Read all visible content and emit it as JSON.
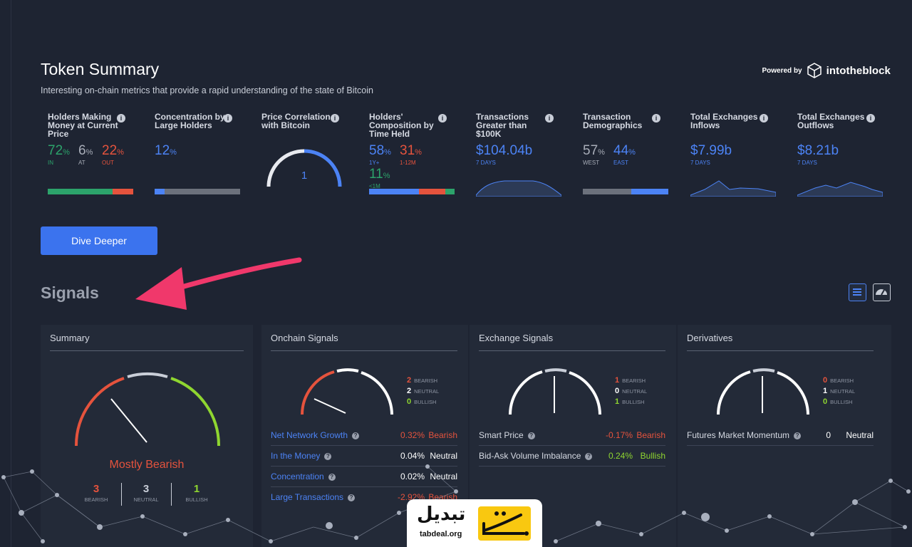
{
  "header": {
    "title": "Token Summary",
    "subtitle": "Interesting on-chain metrics that provide a rapid understanding of the state of Bitcoin",
    "powered_by": "Powered by",
    "brand": "intotheblock"
  },
  "metrics": [
    {
      "title": "Holders Making Money at Current Price",
      "values": [
        {
          "v": "72",
          "unit": "%",
          "label": "IN",
          "color": "#2ca36b"
        },
        {
          "v": "6",
          "unit": "%",
          "label": "AT",
          "color": "#a8adb8"
        },
        {
          "v": "22",
          "unit": "%",
          "label": "OUT",
          "color": "#e5533d"
        }
      ],
      "bar": [
        {
          "pct": 0.76,
          "color": "#2ca36b"
        },
        {
          "pct": 0.24,
          "color": "#e5533d"
        }
      ]
    },
    {
      "title": "Concentration by Large Holders",
      "value": "12",
      "unit": "%",
      "bar": [
        {
          "pct": 0.12,
          "color": "#4c83f5"
        },
        {
          "pct": 0.88,
          "color": "#6c717c"
        }
      ]
    },
    {
      "title": "Price Correlation with Bitcoin",
      "gauge_value": "1"
    },
    {
      "title": "Holders' Composition by Time Held",
      "values": [
        {
          "v": "58",
          "unit": "%",
          "label": "1Y+",
          "color": "#4c83f5"
        },
        {
          "v": "31",
          "unit": "%",
          "label": "1-12M",
          "color": "#e5533d"
        },
        {
          "v": "11",
          "unit": "%",
          "label": "<1M",
          "color": "#2ca36b"
        }
      ],
      "bar": [
        {
          "pct": 0.58,
          "color": "#4c83f5"
        },
        {
          "pct": 0.31,
          "color": "#e5533d"
        },
        {
          "pct": 0.11,
          "color": "#2ca36b"
        }
      ]
    },
    {
      "title": "Transactions Greater than $100K",
      "value": "$104.04b",
      "period": "7 DAYS"
    },
    {
      "title": "Transaction Demographics",
      "values": [
        {
          "v": "57",
          "unit": "%",
          "label": "WEST",
          "color": "#a8adb8"
        },
        {
          "v": "44",
          "unit": "%",
          "label": "EAST",
          "color": "#4c83f5"
        }
      ],
      "bar": [
        {
          "pct": 0.57,
          "color": "#6c717c"
        },
        {
          "pct": 0.43,
          "color": "#4c83f5"
        }
      ]
    },
    {
      "title": "Total Exchanges Inflows",
      "value": "$7.99b",
      "period": "7 DAYS"
    },
    {
      "title": "Total Exchanges Outflows",
      "value": "$8.21b",
      "period": "7 DAYS"
    }
  ],
  "dive_deeper": "Dive Deeper",
  "signals": {
    "title": "Signals",
    "summary": {
      "title": "Summary",
      "status": "Mostly Bearish",
      "bearish": "3",
      "neutral": "3",
      "bullish": "1",
      "bearish_label": "BEARISH",
      "neutral_label": "NEUTRAL",
      "bullish_label": "BULLISH"
    },
    "onchain": {
      "title": "Onchain Signals",
      "bearish": "2",
      "neutral": "2",
      "bullish": "0",
      "rows": [
        {
          "name": "Net Network Growth",
          "value": "0.32%",
          "signal": "Bearish"
        },
        {
          "name": "In the Money",
          "value": "0.04%",
          "signal": "Neutral"
        },
        {
          "name": "Concentration",
          "value": "0.02%",
          "signal": "Neutral"
        },
        {
          "name": "Large Transactions",
          "value": "-2.92%",
          "signal": "Bearish"
        }
      ]
    },
    "exchange": {
      "title": "Exchange Signals",
      "bearish": "1",
      "neutral": "0",
      "bullish": "1",
      "rows": [
        {
          "name": "Smart Price",
          "value": "-0.17%",
          "signal": "Bearish"
        },
        {
          "name": "Bid-Ask Volume Imbalance",
          "value": "0.24%",
          "signal": "Bullish"
        }
      ]
    },
    "derivatives": {
      "title": "Derivatives",
      "bearish": "0",
      "neutral": "1",
      "bullish": "0",
      "rows": [
        {
          "name": "Futures Market Momentum",
          "value": "0",
          "signal": "Neutral"
        }
      ]
    },
    "legend_labels": {
      "bearish": "BEARISH",
      "neutral": "NEUTRAL",
      "bullish": "BULLISH"
    }
  },
  "watermark": {
    "text": "تبدیل",
    "url": "tabdeal.org"
  },
  "colors": {
    "bearish": "#e5533d",
    "neutral": "#ffffff",
    "bullish": "#8fd630",
    "accent": "#4c83f5",
    "arrow": "#f0386b"
  }
}
